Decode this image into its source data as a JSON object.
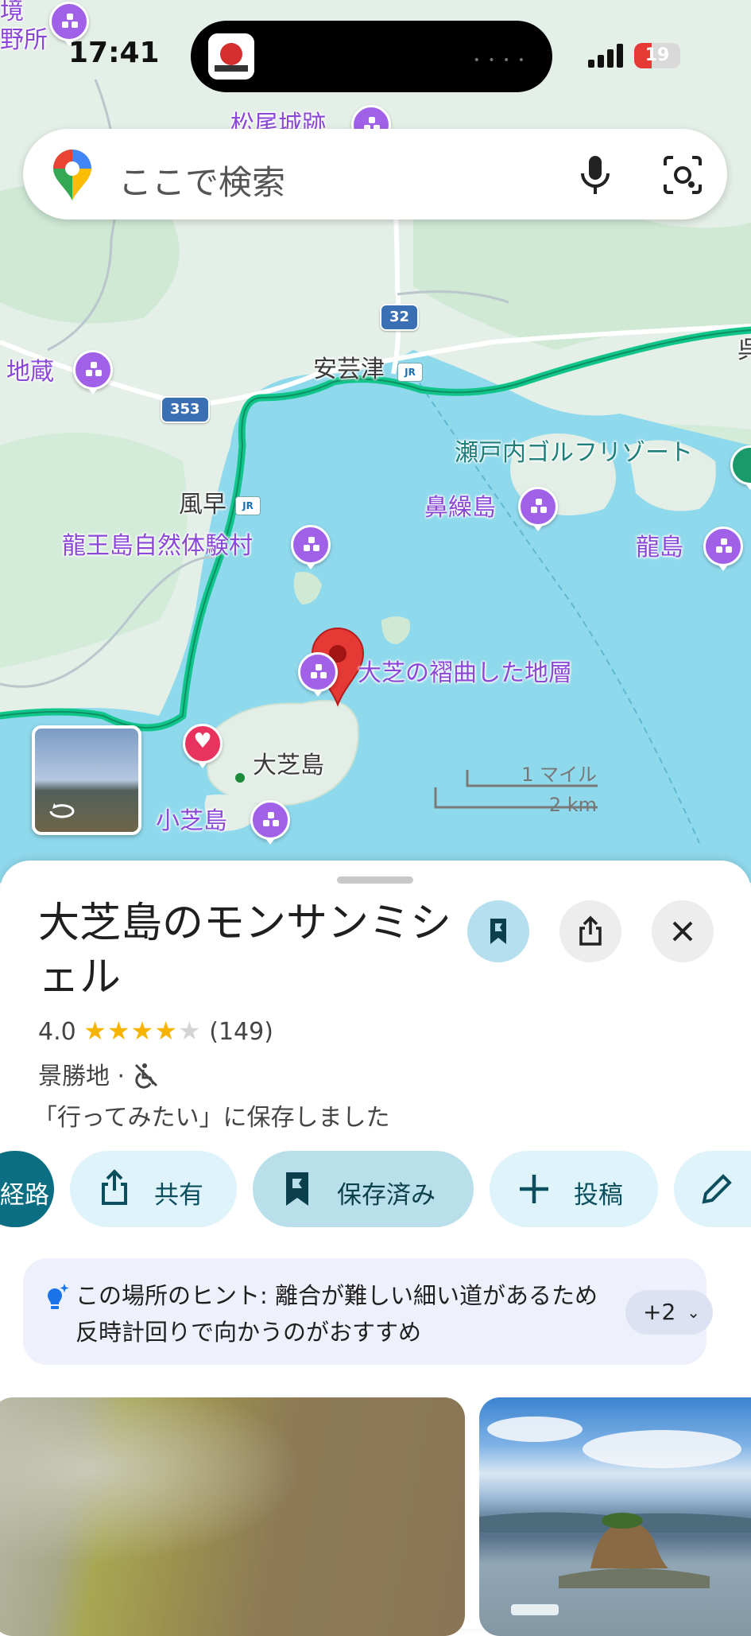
{
  "status_bar": {
    "time": "17:41",
    "battery": "19"
  },
  "search": {
    "placeholder": "ここで検索",
    "icons": [
      "maps-pin-logo-icon",
      "microphone-icon",
      "camera-lens-icon"
    ]
  },
  "map": {
    "labels": {
      "top_left_1": "境",
      "top_left_2": "野所",
      "castle": "松尾城跡",
      "jizo": "地蔵",
      "aki_tsu": "安芸津",
      "kazahaya": "風早",
      "golf": "瀬戸内ゴルフリゾート",
      "hanakuri": "鼻繰島",
      "ryuoto": "龍王島自然体験村",
      "ryujima": "龍島",
      "fold": "大芝の褶曲した地層",
      "oshiba": "大芝島",
      "koshiba": "小芝島",
      "right_edge": "呉"
    },
    "route_shields": [
      "32",
      "353"
    ],
    "scale": {
      "miles": "1 マイル",
      "km": "2 km"
    }
  },
  "place": {
    "title": "大芝島のモンサンミシェル",
    "rating": "4.0",
    "stars": "★★★★",
    "stars_empty": "★",
    "review_count": "(149)",
    "category": "景勝地 ·",
    "saved_message": "「行ってみたい」に保存しました"
  },
  "chips": {
    "route": "経路",
    "share": "共有",
    "saved": "保存済み",
    "post": "投稿"
  },
  "hint": {
    "text": "この場所のヒント: 離合が難しい細い道があるため反時計回りで向かうのがおすすめ",
    "more": "+2"
  },
  "colors": {
    "accent": "#0b6e82",
    "chip_bg": "#dff3fa",
    "poi_purple": "#a061e8",
    "pin_red": "#e53935",
    "sea": "#8fd9ec",
    "land": "#e3efe6"
  }
}
